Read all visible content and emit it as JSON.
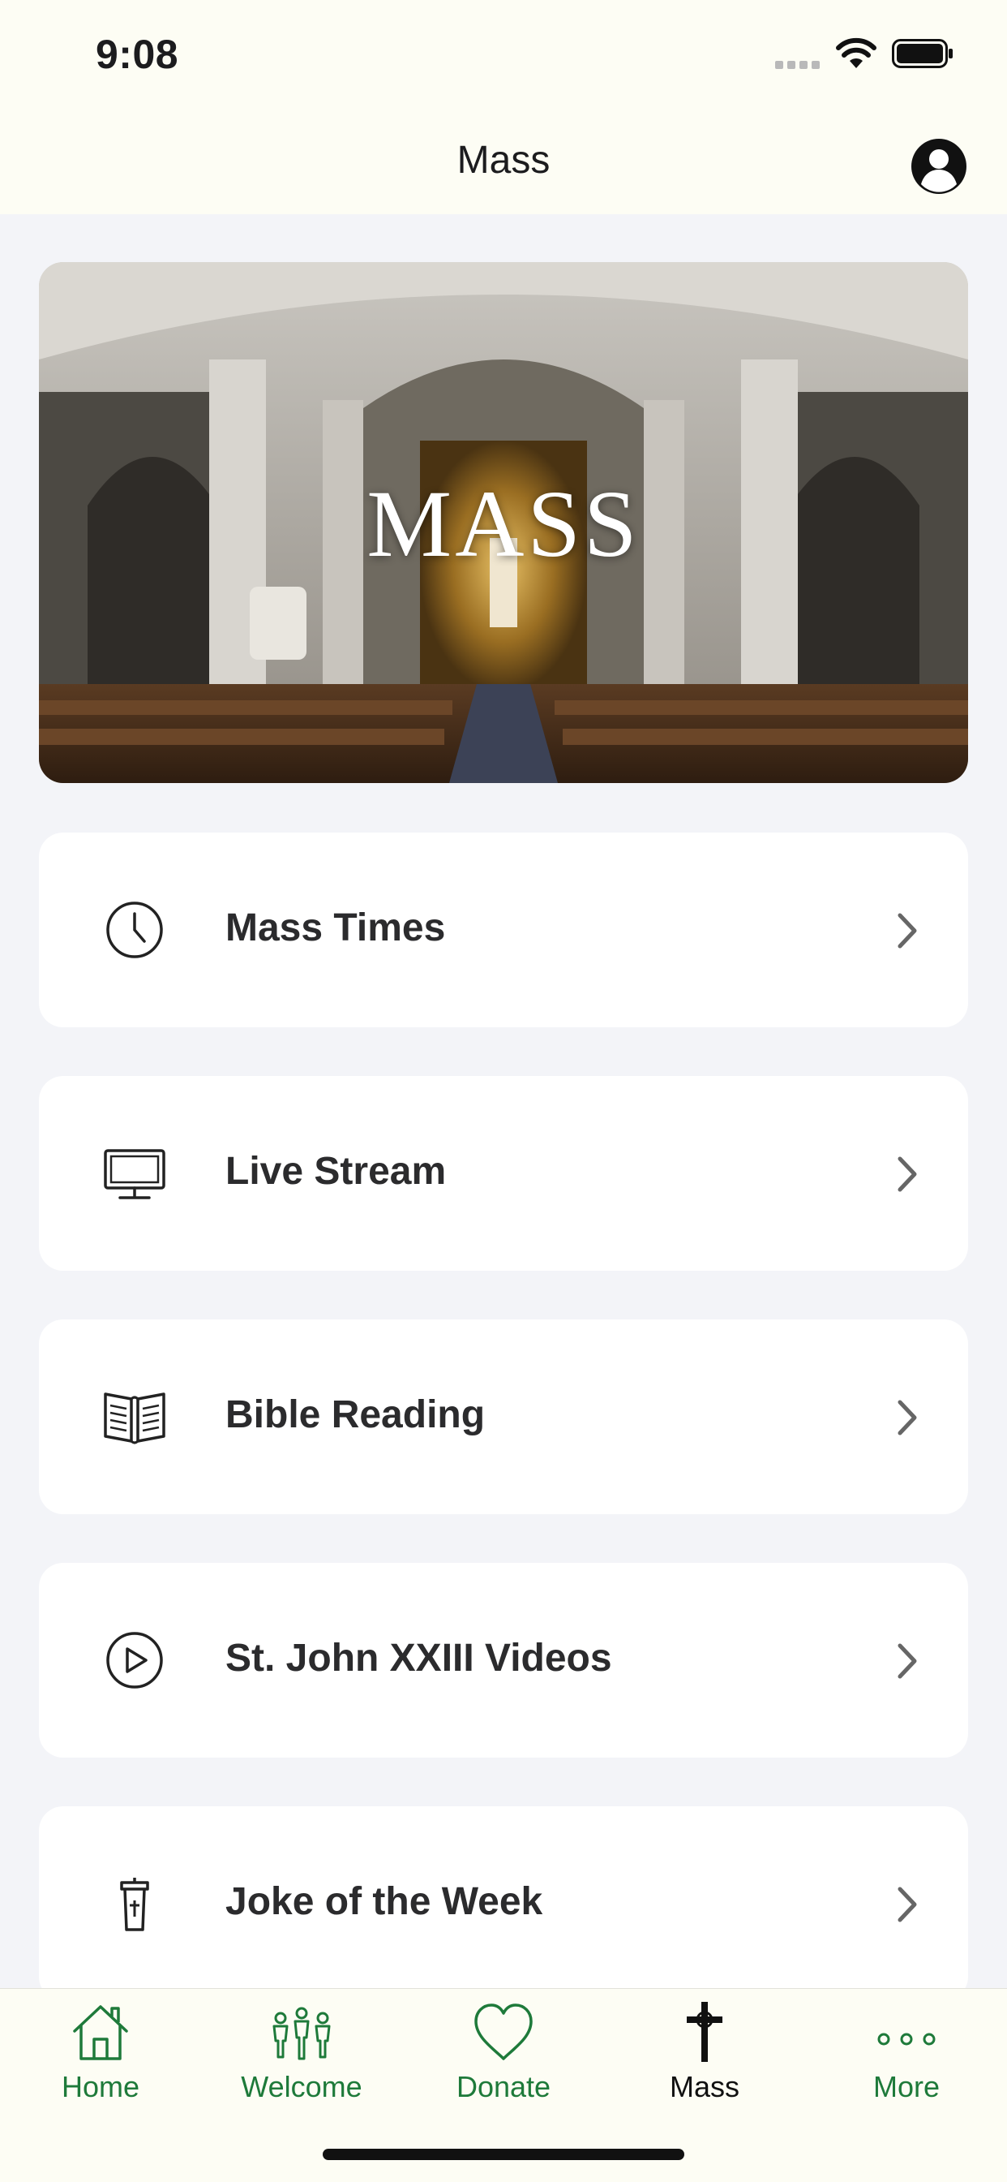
{
  "status_bar": {
    "time": "9:08"
  },
  "nav": {
    "title": "Mass"
  },
  "hero": {
    "text": "MASS"
  },
  "menu": [
    {
      "label": "Mass Times",
      "icon": "clock-icon"
    },
    {
      "label": "Live Stream",
      "icon": "monitor-icon"
    },
    {
      "label": "Bible Reading",
      "icon": "book-icon"
    },
    {
      "label": "St. John XXIII Videos",
      "icon": "play-circle-icon"
    },
    {
      "label": "Joke of the Week",
      "icon": "podium-icon"
    }
  ],
  "tabs": [
    {
      "label": "Home",
      "icon": "home-icon",
      "active": false
    },
    {
      "label": "Welcome",
      "icon": "people-icon",
      "active": false
    },
    {
      "label": "Donate",
      "icon": "heart-icon",
      "active": false
    },
    {
      "label": "Mass",
      "icon": "cross-icon",
      "active": true
    },
    {
      "label": "More",
      "icon": "more-dots-icon",
      "active": false
    }
  ],
  "colors": {
    "accent": "#1e7a3a",
    "bar_background": "#fdfdf4",
    "page_background": "#f3f4f8",
    "card_background": "#ffffff"
  }
}
